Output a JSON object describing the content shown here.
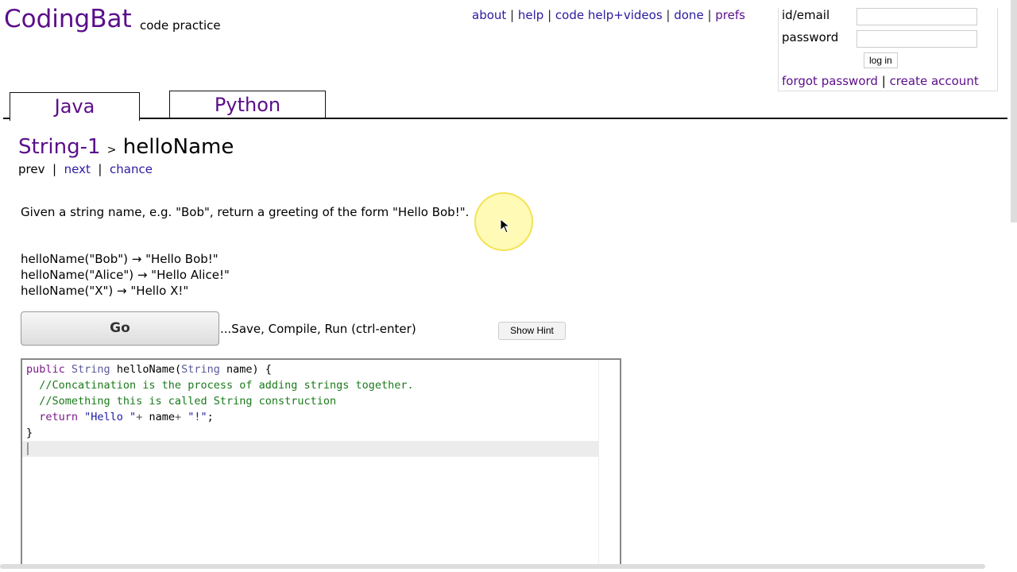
{
  "header": {
    "logo": "CodingBat",
    "tagline": "code practice",
    "links": [
      "about",
      "help",
      "code help+videos",
      "done",
      "prefs"
    ]
  },
  "login": {
    "id_label": "id/email",
    "password_label": "password",
    "id_value": "",
    "password_value": "",
    "login_button": "log in",
    "forgot": "forgot password",
    "create": "create account",
    "sep": "|"
  },
  "tabs": [
    "Java",
    "Python"
  ],
  "breadcrumb": {
    "section": "String-1",
    "sep": ">",
    "problem": "helloName"
  },
  "nav": {
    "prev": "prev",
    "next": "next",
    "chance": "chance",
    "sep": "|"
  },
  "description": "Given a string name, e.g. \"Bob\", return a greeting of the form \"Hello Bob!\".",
  "examples": [
    "helloName(\"Bob\") → \"Hello Bob!\"",
    "helloName(\"Alice\") → \"Hello Alice!\"",
    "helloName(\"X\") → \"Hello X!\""
  ],
  "go_button": "Go",
  "go_text": "...Save, Compile, Run (ctrl-enter)",
  "hint_button": "Show Hint",
  "code": [
    [
      [
        "public ",
        "#7a1a8a"
      ],
      [
        "String ",
        "#5a5a9a"
      ],
      [
        "helloName(",
        "#000"
      ],
      [
        "String ",
        "#5a5a9a"
      ],
      [
        "name) {",
        "#000"
      ]
    ],
    [
      [
        "  //Concatination is the process of adding strings together.",
        "#1a7a1a"
      ]
    ],
    [
      [
        "  //Something this is called String construction",
        "#1a7a1a"
      ]
    ],
    [
      [
        "  return ",
        "#7a1a8a"
      ],
      [
        "\"Hello \"",
        "#1a1aa0"
      ],
      [
        "+ ",
        "#555"
      ],
      [
        "name",
        "#000"
      ],
      [
        "+ ",
        "#555"
      ],
      [
        "\"!\"",
        "#1a1aa0"
      ],
      [
        ";",
        "#000"
      ]
    ],
    [
      [
        "}",
        "#000"
      ]
    ]
  ]
}
